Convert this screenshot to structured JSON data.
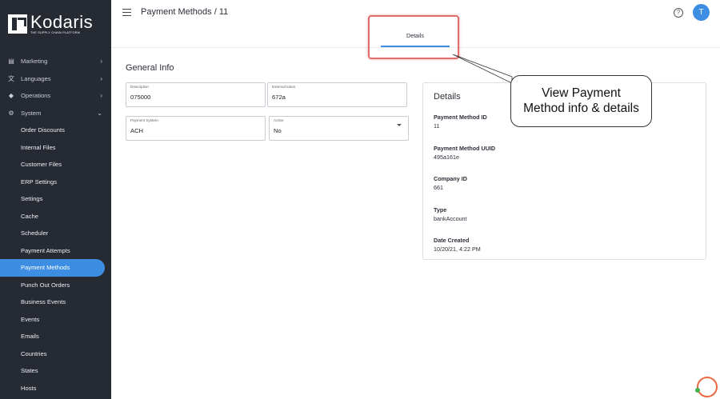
{
  "app": {
    "brand": "Kodaris",
    "tagline": "THE SUPPLY CHAIN PLATFORM"
  },
  "header": {
    "title": "Payment Methods / 11",
    "avatar_initial": "T",
    "help_symbol": "?"
  },
  "tabs": [
    {
      "label": "Details",
      "active": true
    }
  ],
  "sidebar": {
    "items": [
      {
        "label": "Marketing",
        "icon": "marketing-icon",
        "chevron": "›"
      },
      {
        "label": "Languages",
        "icon": "languages-icon",
        "chevron": "›"
      },
      {
        "label": "Operations",
        "icon": "operations-icon",
        "chevron": "›"
      },
      {
        "label": "System",
        "icon": "gear-icon",
        "chevron": "⌄"
      }
    ],
    "sub_items": [
      {
        "label": "Order Discounts"
      },
      {
        "label": "Internal Files"
      },
      {
        "label": "Customer Files"
      },
      {
        "label": "ERP Settings"
      },
      {
        "label": "Settings"
      },
      {
        "label": "Cache"
      },
      {
        "label": "Scheduler"
      },
      {
        "label": "Payment Attempts"
      },
      {
        "label": "Payment Methods",
        "active": true
      },
      {
        "label": "Punch Out Orders"
      },
      {
        "label": "Business Events"
      },
      {
        "label": "Events"
      },
      {
        "label": "Emails"
      },
      {
        "label": "Countries"
      },
      {
        "label": "States"
      },
      {
        "label": "Hosts"
      }
    ]
  },
  "general_info": {
    "title": "General Info",
    "description": {
      "label": "Description",
      "value": "075000"
    },
    "external_token": {
      "label": "External token",
      "value": "672a"
    },
    "payment_system": {
      "label": "Payment System",
      "value": "ACH"
    },
    "active": {
      "label": "Active",
      "value": "No"
    }
  },
  "details_card": {
    "title": "Details",
    "payment_method_id": {
      "label": "Payment Method ID",
      "value": "11"
    },
    "payment_method_uuid": {
      "label": "Payment Method UUID",
      "value": "495a161e"
    },
    "company_id": {
      "label": "Company ID",
      "value": "661"
    },
    "type": {
      "label": "Type",
      "value": "bankAccount"
    },
    "date_created": {
      "label": "Date Created",
      "value": "10/20/21, 4:22 PM"
    }
  },
  "annotation": {
    "line1": "View Payment",
    "line2": "Method info & details"
  },
  "colors": {
    "accent": "#3d8ee3",
    "sidebar_bg": "#262a33",
    "highlight": "#e06c6c",
    "chat": "#e9683f"
  }
}
